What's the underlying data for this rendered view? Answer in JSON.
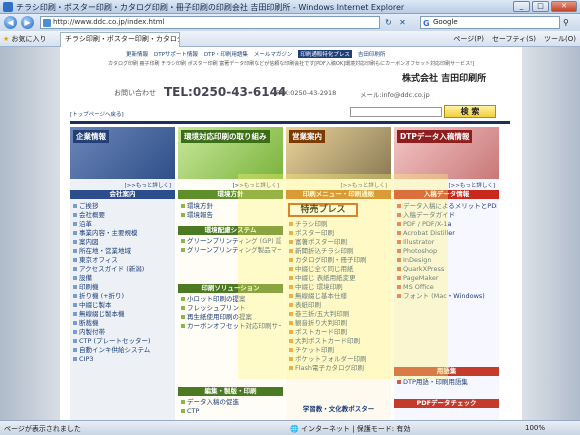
{
  "window": {
    "title": "チラシ印刷・ポスター印刷・カタログ印刷・冊子印刷の印刷会社 吉田印刷所 - Windows Internet Explorer",
    "min": "_",
    "max": "□",
    "close": "✕"
  },
  "address": {
    "url": "http://www.ddc.co.jp/index.html",
    "search_placeholder": "Google"
  },
  "favorites": {
    "label": "お気に入り",
    "tab": "チラシ印刷・ポスター印刷・カタログ印刷・冊子..."
  },
  "toolbar": [
    "ページ(P)",
    "セーフティ(S)",
    "ツール(O)"
  ],
  "site": {
    "topnav": [
      "更新情報",
      "DTPサポート情報",
      "DTP・印刷用語集",
      "メールマガジン",
      "印刷通販特化プレス",
      "吉田印刷所"
    ],
    "tagline": "カタログ印刷 冊子印刷 チラシ印刷 ポスター印刷 富著データ印刷などが信頼な印刷会社です[PDF入稿OK]環境対応印刷もにカーボンオフセット対応印刷サービス!]",
    "company": "株式会社 吉田印刷所",
    "contact_label": "お問い合わせ",
    "tel": "TEL:0250-43-6144",
    "fax": "FAX:0250-43-2918",
    "mail": "メール:info@ddc.co.jp",
    "search_btn": "検 索",
    "breadcrumb": "[トップページへ戻る]",
    "more": "[>>もっと詳しく]"
  },
  "columns": [
    {
      "banner": "企業情報",
      "head": "会社案内",
      "items": [
        "ご挨拶",
        "会社概要",
        "沿革",
        "事業内容・主要規模",
        "案内図",
        "所在地・営業地域",
        "東京オフィス",
        "アクセスガイド (新潟)",
        "設備",
        "印刷機",
        "折り機 (+折り)",
        "中綴じ製本",
        "無線綴じ製本機",
        "断裁機",
        "内製付帯",
        "CTP (プレートセッター)",
        "自動インキ供給システム",
        "CIP3"
      ]
    },
    {
      "banner": "環境対応印刷の取り組み",
      "head": "環境方針",
      "items": [
        "環境方針",
        "環境報告"
      ],
      "sub1": "環境配慮システム",
      "items2": [
        "グリーンプリンティング (GP) 認定工場",
        "グリーンプリンティング製品マーク (GP製品マーク)"
      ],
      "sub2": "印刷ソリューション",
      "items3": [
        "小ロット印刷の提案",
        "フレッシュプリント",
        "再生紙使用印刷の提案",
        "カーボンオフセット対応印刷サービス"
      ],
      "sub3": "編集・製版・印刷",
      "items4": [
        "データ入稿の促進",
        "CTP"
      ]
    },
    {
      "banner": "営業案内",
      "head": "印刷メニュー・印刷通販",
      "toku": "特売プレス",
      "items": [
        "チラシ印刷",
        "ポスター印刷",
        "富著ポスター印刷",
        "新聞折込チラシ印刷",
        "カタログ印刷・冊子印刷",
        "中綴じ全て同じ用紙",
        "中綴じ 表紙用紙変更",
        "中綴じ 環境印刷",
        "無線綴じ基本仕様",
        "表紙印刷",
        "巻三折/五大判印刷",
        "観音折り大判印刷",
        "ポストカード印刷",
        "大判ポストカード印刷",
        "チケット印刷",
        "ポケットフォルダー印刷",
        "Flash電子カタログ印刷"
      ],
      "sub1": "学習教・文化教ポスター"
    },
    {
      "banner": "DTPデータ入稿情報",
      "head": "入稿データ情報",
      "items": [
        "データ入稿によるメリットとPDF入稿について【1 2 3】",
        "入稿データガイド",
        "PDF / PDF/X-1a",
        "Acrobat Distiller",
        "Illustrator",
        "Photoshop",
        "InDesign",
        "QuarkXPress",
        "PageMaker",
        "MS Office",
        "フォント (Mac・Windows)"
      ],
      "sub1": "用語集",
      "items2": [
        "DTP用語・印刷用語集"
      ],
      "sub2": "PDFデータチェック"
    }
  ],
  "status": {
    "text": "ページが表示されました",
    "zone": "インターネット",
    "protect": "保護モード: 有効",
    "zoom": "100%"
  }
}
